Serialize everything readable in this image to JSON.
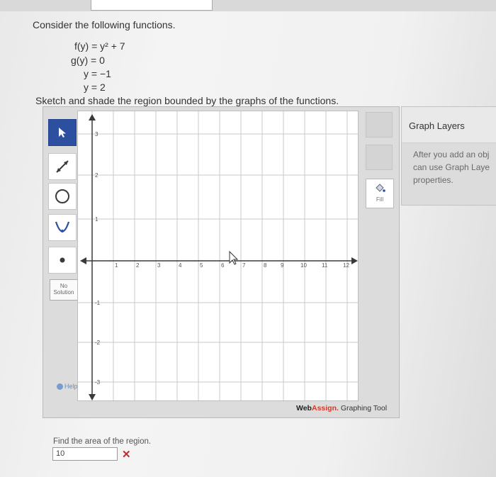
{
  "problem": {
    "intro": "Consider the following functions.",
    "functions": [
      "f(y) = y² + 7",
      "g(y) = 0",
      "y = −1",
      "y = 2"
    ],
    "sketch_instruction": "Sketch and shade the region bounded by the graphs of the functions."
  },
  "toolbar": {
    "tools": [
      "pointer-icon",
      "line-icon",
      "circle-icon",
      "parabola-icon",
      "point-icon"
    ],
    "no_solution_label": "No Solution",
    "help_label": "Help"
  },
  "graph": {
    "x_ticks": [
      "1",
      "2",
      "3",
      "4",
      "5",
      "6",
      "7",
      "8",
      "9",
      "10",
      "11",
      "12"
    ],
    "y_ticks": [
      "3",
      "2",
      "1",
      "-1",
      "-2",
      "-3"
    ]
  },
  "right_tools": {
    "fill_label": "Fill"
  },
  "brand": {
    "web": "Web",
    "assign": "Assign.",
    "tool": " Graphing Tool"
  },
  "layers": {
    "title": "Graph Layers",
    "desc_lines": [
      "After you add an obj",
      "can use Graph Laye",
      "properties."
    ]
  },
  "answer": {
    "prompt": "Find the area of the region.",
    "value": "10",
    "status_mark": "✕"
  },
  "colors": {
    "active_tool": "#2c4fa0",
    "incorrect": "#d0262b",
    "brand_accent": "#d23a2a"
  }
}
